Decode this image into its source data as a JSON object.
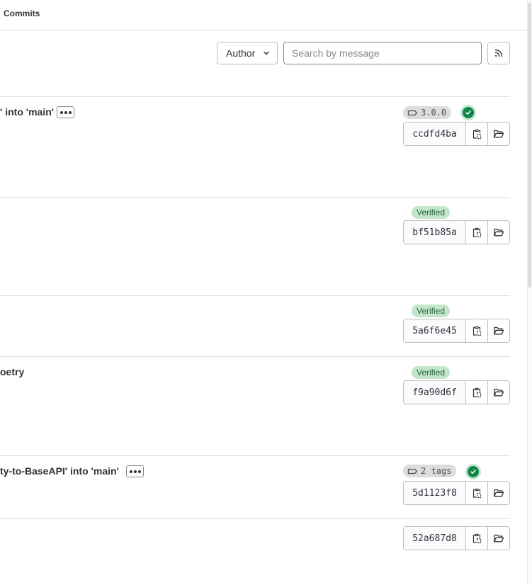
{
  "breadcrumb": {
    "current": "Commits"
  },
  "filters": {
    "author_label": "Author",
    "search_placeholder": "Search by message"
  },
  "commits": [
    {
      "title": "' into 'main'",
      "has_ellipsis": true,
      "tag": "3.0.0",
      "pipeline": "passed",
      "verified": null,
      "sha": "ccdfd4ba"
    },
    {
      "title": "",
      "has_ellipsis": false,
      "tag": null,
      "pipeline": null,
      "verified": "Verified",
      "sha": "bf51b85a"
    },
    {
      "title": "",
      "has_ellipsis": false,
      "tag": null,
      "pipeline": null,
      "verified": "Verified",
      "sha": "5a6f6e45"
    },
    {
      "title": "oetry",
      "has_ellipsis": false,
      "tag": null,
      "pipeline": null,
      "verified": "Verified",
      "sha": "f9a90d6f"
    },
    {
      "title": "ty-to-BaseAPI' into 'main'",
      "has_ellipsis": true,
      "tag": "2 tags",
      "pipeline": "passed",
      "verified": null,
      "sha": "5d1123f8"
    },
    {
      "title": "",
      "has_ellipsis": false,
      "tag": null,
      "pipeline": null,
      "verified": null,
      "sha": "52a687d8"
    }
  ],
  "colors": {
    "pipeline_success": "#108548",
    "verified_bg": "#c3e6cd",
    "verified_text": "#24663b",
    "tag_bg": "#dcdcde"
  }
}
